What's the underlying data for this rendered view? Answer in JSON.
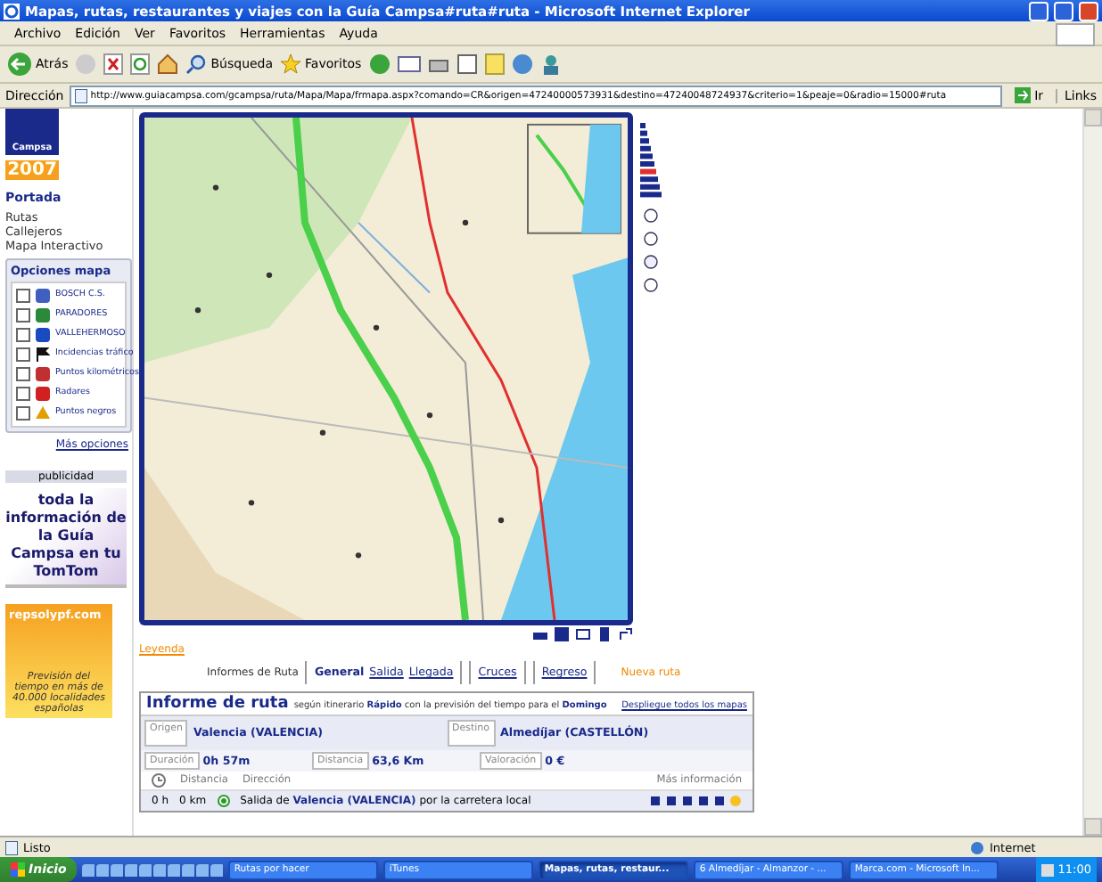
{
  "window": {
    "title": "Mapas, rutas, restaurantes y viajes con la Guía Campsa#ruta#ruta - Microsoft Internet Explorer"
  },
  "menu": [
    "Archivo",
    "Edición",
    "Ver",
    "Favoritos",
    "Herramientas",
    "Ayuda"
  ],
  "toolbar": {
    "back": "Atrás",
    "search": "Búsqueda",
    "favorites": "Favoritos"
  },
  "address": {
    "label": "Dirección",
    "value": "http://www.guiacampsa.com/gcampsa/ruta/Mapa/Mapa/frmapa.aspx?comando=CR&origen=47240000573931&destino=47240048724937&criterio=1&peaje=0&radio=15000#ruta",
    "go": "Ir",
    "links": "Links"
  },
  "sidebar": {
    "logo_brand": "Campsa",
    "logo_year": "2007",
    "home": "Portada",
    "links": [
      "Rutas",
      "Callejeros",
      "Mapa Interactivo"
    ],
    "map_options": {
      "title": "Opciones mapa",
      "more": "Más opciones",
      "items": [
        {
          "label": "BOSCH C.S.",
          "checked": false
        },
        {
          "label": "PARADORES",
          "checked": false
        },
        {
          "label": "VALLEHERMOSO",
          "checked": false
        },
        {
          "label": "Incidencias tráfico",
          "checked": false
        },
        {
          "label": "Puntos kilométricos",
          "checked": false
        },
        {
          "label": "Radares",
          "checked": false
        },
        {
          "label": "Puntos negros",
          "checked": false
        }
      ]
    },
    "ads_header": "publicidad",
    "ad_tomtom": "toda la información de la Guía Campsa en tu TomTom",
    "ad_repsol": {
      "brand": "repsolypf.com",
      "text": "Previsión del tiempo en más de 40.000 localidades españolas"
    }
  },
  "legend": "Leyenda",
  "report_tabs": {
    "label": "Informes de Ruta",
    "new_route": "Nueva ruta",
    "tabs": [
      {
        "label": "General",
        "selected": true
      },
      {
        "label": "Salida",
        "selected": false
      },
      {
        "label": "Llegada",
        "selected": false
      },
      {
        "label": "Cruces",
        "selected": false
      },
      {
        "label": "Regreso",
        "selected": false
      }
    ]
  },
  "report": {
    "title": "Informe de ruta",
    "subtitle": "según itinerario **Rápido** con la previsión del tiempo para el **Domingo**",
    "expand_link": "Despliegue todos los mapas",
    "origin": {
      "label": "Origen",
      "value": "Valencia (VALENCIA)"
    },
    "destination": {
      "label": "Destino",
      "value": "Almedíjar (CASTELLÓN)"
    },
    "stats": [
      {
        "label": "Duración",
        "value": "0h 57m"
      },
      {
        "label": "Distancia",
        "value": "63,6 Km"
      },
      {
        "label": "Valoración",
        "value": "0 €"
      }
    ],
    "columns": [
      "Distancia",
      "Dirección",
      "Más información"
    ],
    "steps": [
      {
        "time": "0 h",
        "distance": "0 km",
        "text": "Salida de **Valencia (VALENCIA)** por la carretera local"
      }
    ]
  },
  "status_bar": {
    "text": "Listo",
    "zone": "Internet"
  },
  "taskbar": {
    "start": "Inicio",
    "clock": "11:00",
    "tasks": [
      {
        "label": "Rutas por hacer",
        "selected": false
      },
      {
        "label": "iTunes",
        "selected": false
      },
      {
        "label": "Mapas, rutas, restaur...",
        "selected": true
      },
      {
        "label": "6 Almedíjar - Almanzor - ...",
        "selected": false
      },
      {
        "label": "Marca.com - Microsoft In...",
        "selected": false
      }
    ]
  }
}
